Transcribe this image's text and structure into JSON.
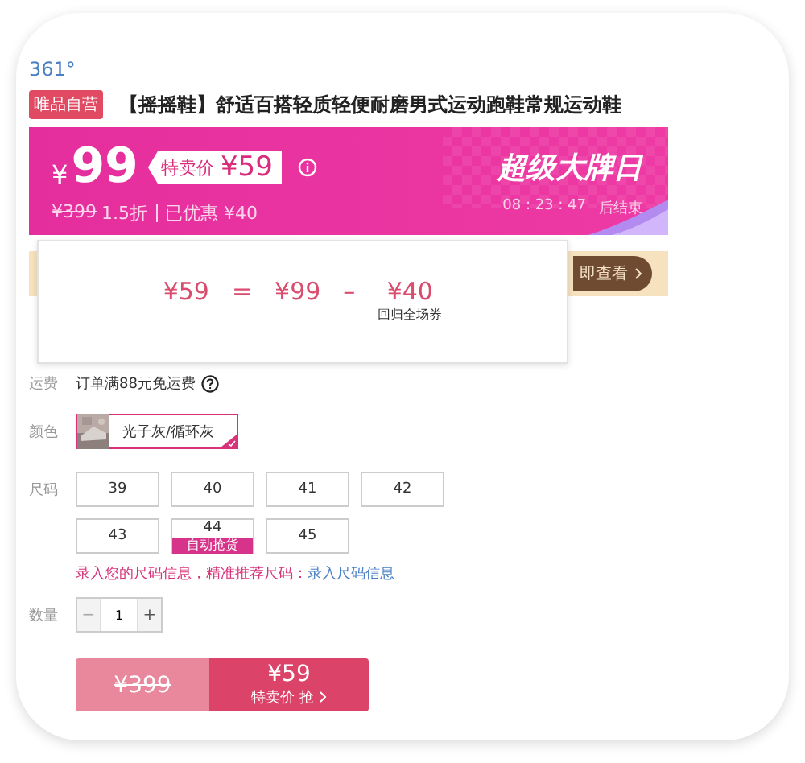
{
  "brand": "361°",
  "badge": "唯品自营",
  "title": "【摇摇鞋】舒适百搭轻质轻便耐磨男式运动跑鞋常规运动鞋",
  "price_banner": {
    "currency": "¥",
    "price": "99",
    "special_label": "特卖价",
    "special_price": "¥59",
    "original_price": "¥399",
    "discount": "1.5折",
    "saved": "已优惠 ¥40",
    "campaign": "超级大牌日",
    "countdown": "08 : 23 : 47",
    "countdown_suffix": "后结束"
  },
  "coupon_strip": {
    "button": "即查看"
  },
  "popup": {
    "formula": [
      "¥59",
      "=",
      "¥99",
      "–",
      "¥40"
    ],
    "note": "回归全场券"
  },
  "shipping": {
    "label": "运费",
    "text": "订单满88元免运费"
  },
  "color": {
    "label": "颜色",
    "options": [
      {
        "label": "光子灰/循环灰",
        "selected": true
      }
    ]
  },
  "size": {
    "label": "尺码",
    "options": [
      {
        "label": "39",
        "selected": false
      },
      {
        "label": "40",
        "selected": false
      },
      {
        "label": "41",
        "selected": false
      },
      {
        "label": "42",
        "selected": false
      },
      {
        "label": "43",
        "selected": false
      },
      {
        "label": "44",
        "selected": false,
        "tag": "自动抢货"
      },
      {
        "label": "45",
        "selected": false
      }
    ]
  },
  "size_hint": {
    "text": "录入您的尺码信息，精准推荐尺码：",
    "link": "录入尺码信息"
  },
  "quantity": {
    "label": "数量",
    "value": "1",
    "decrement": "−",
    "increment": "+",
    "decrement_disabled": true
  },
  "buy": {
    "original_price": "¥399",
    "price": "¥59",
    "action": "特卖价 抢"
  }
}
